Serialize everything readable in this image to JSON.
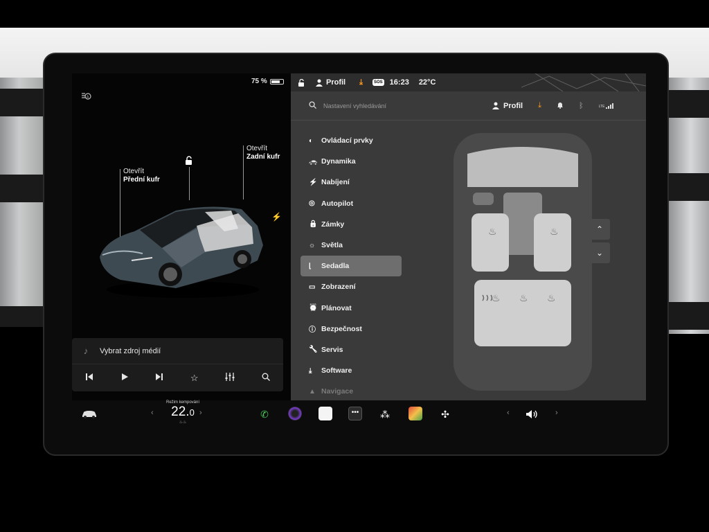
{
  "status": {
    "battery_percent": "75 %",
    "battery_level": 0.75,
    "profile": "Profil",
    "sos": "SOS",
    "time": "16:23",
    "temperature": "22°C"
  },
  "left": {
    "front_trunk": {
      "action": "Otevřít",
      "name": "Přední kufr"
    },
    "rear_trunk": {
      "action": "Otevřít",
      "name": "Zadní kufr"
    },
    "media": {
      "source_label": "Vybrat zdroj médií",
      "controls": [
        "previous-icon",
        "play-icon",
        "next-icon",
        "star-icon",
        "equalizer-icon",
        "search-icon"
      ]
    }
  },
  "settings": {
    "search_placeholder": "Nastavení vyhledávání",
    "profile_label": "Profil",
    "signal_label": "LTE",
    "menu": [
      {
        "label": "Ovládací prvky",
        "icon": "toggle-icon"
      },
      {
        "label": "Dynamika",
        "icon": "car-icon"
      },
      {
        "label": "Nabíjení",
        "icon": "bolt-icon"
      },
      {
        "label": "Autopilot",
        "icon": "steering-wheel-icon"
      },
      {
        "label": "Zámky",
        "icon": "lock-icon"
      },
      {
        "label": "Světla",
        "icon": "sun-icon"
      },
      {
        "label": "Sedadla",
        "icon": "seat-icon",
        "active": true
      },
      {
        "label": "Zobrazení",
        "icon": "display-icon"
      },
      {
        "label": "Plánovat",
        "icon": "clock-icon"
      },
      {
        "label": "Bezpečnost",
        "icon": "alert-icon"
      },
      {
        "label": "Servis",
        "icon": "wrench-icon"
      },
      {
        "label": "Software",
        "icon": "download-icon"
      },
      {
        "label": "Navigace",
        "icon": "navigation-icon",
        "faded": true
      }
    ]
  },
  "dock": {
    "climate_mode": "Režim kempování",
    "temp_main": "22.",
    "temp_decimal": "0"
  },
  "colors": {
    "accent_orange": "#ff9a20",
    "active_menu_bg": "#6e6e6e",
    "panel_bg": "#3a3a3a"
  }
}
